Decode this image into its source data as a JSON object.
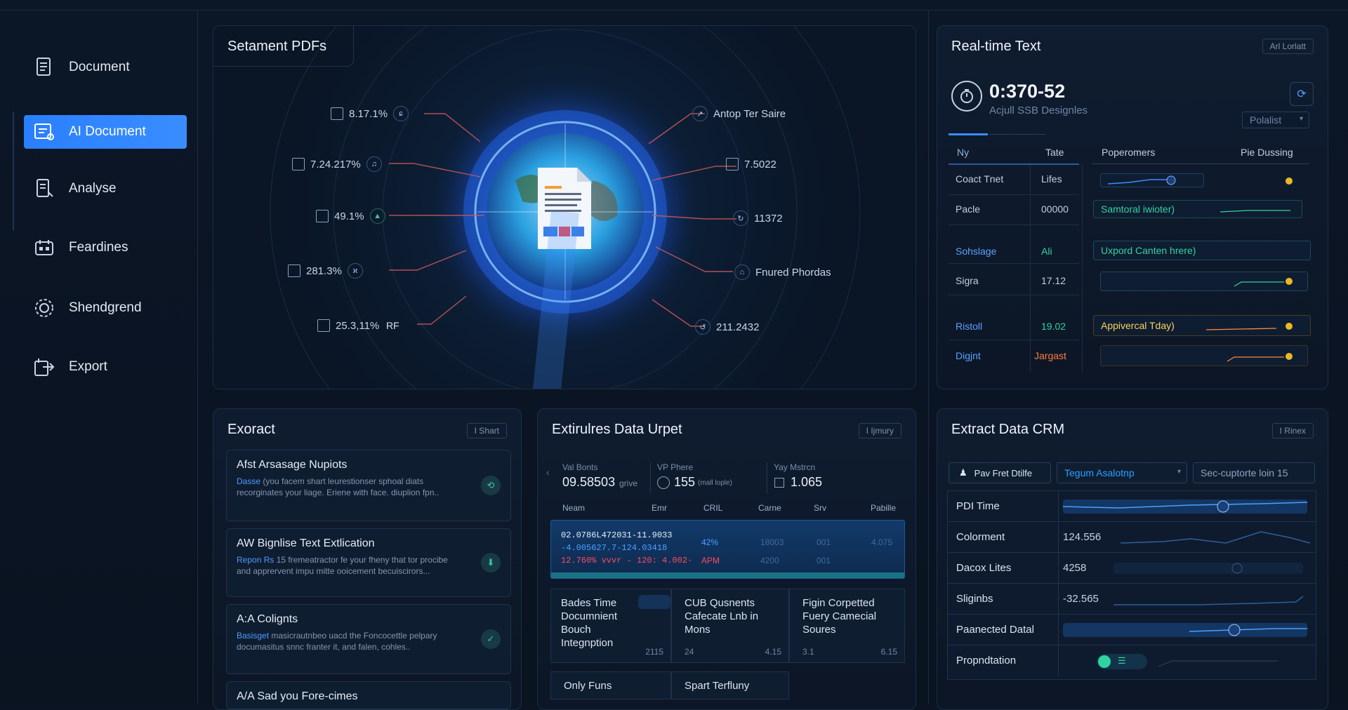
{
  "sidebar": {
    "items": [
      {
        "label": "Document",
        "icon": "document-icon"
      },
      {
        "label": "AI Document",
        "icon": "ai-document-icon",
        "active": true
      },
      {
        "label": "Analyse",
        "icon": "analyse-icon"
      },
      {
        "label": "Feardines",
        "icon": "feardines-icon"
      },
      {
        "label": "Shendgrend",
        "icon": "settings-gear-icon"
      },
      {
        "label": "Export",
        "icon": "export-icon"
      }
    ]
  },
  "viz": {
    "title": "Setament PDFs",
    "left_labels": [
      "8.17.1%",
      "7.24.217%",
      "49.1%",
      "281.3%",
      "25.3,11%"
    ],
    "left_icon_texts": [
      "ɕ",
      "♫",
      "▲",
      "ϰ",
      "RF"
    ],
    "right_labels": [
      "Antop Ter Saire",
      "7.5022",
      "11372",
      "Fnured Phordas",
      "211.2432"
    ]
  },
  "realtime": {
    "title": "Real-time Text",
    "chip": "Arl Lorlatt",
    "time": "0:370-52",
    "subtitle": "Acjull SSB Designles",
    "dropdown": "Polalist",
    "headers": [
      "Ny",
      "Tate",
      "Poperomers",
      "Pie Dussing"
    ],
    "rows": [
      {
        "name": "Coact Tnet",
        "val": "Lifes",
        "bar": ""
      },
      {
        "name": "Pacle",
        "val": "00000",
        "bar": "Samtoral iwioter)"
      },
      {
        "name": "Sohslage",
        "val": "Ali",
        "bar": "Uxpord Canten hrere)"
      },
      {
        "name": "Sigra",
        "val": "17.12",
        "bar": ""
      },
      {
        "name": "Ristoll",
        "val": "19.02",
        "bar": "Appivercal Tday)"
      },
      {
        "name": "Digjnt",
        "val": "Jargast",
        "bar": ""
      }
    ]
  },
  "extract": {
    "title": "Exoract",
    "chip": "I Shart",
    "cards": [
      {
        "title": "Afst Arsasage Nupiots",
        "lead": "Dasse",
        "body": "(you facem shart leurestionser sphoal diats recorginates your liage. Eriene with face. diuplion fpn.."
      },
      {
        "title": "AW Bignlise Text Extlication",
        "lead": "Repon Rs",
        "body": "15 fremeatractor fe your fheny that tor procibe and apprervent impu mitte ooicement becuiscirors..."
      },
      {
        "title": "A:A Colignts",
        "lead": "Basisget",
        "body": "masicrautnbeo uacd the Foncocettle pelpary documasitus snnc franter it, and falen, cohles.."
      },
      {
        "title": "A/A Sad you Fore-cimes",
        "lead": "",
        "body": ""
      }
    ]
  },
  "midtable": {
    "title": "Extirulres Data Urpet",
    "chip": "I Ijmury",
    "stats": [
      {
        "label": "Val Bonts",
        "value": "09.58503",
        "unit": "grive"
      },
      {
        "label": "VP Phere",
        "value": "155",
        "unit": "(mall lople)"
      },
      {
        "label": "Yay Mstrcn",
        "value": "1.065",
        "unit": ""
      }
    ],
    "headers": [
      "Neam",
      "Emr",
      "CRIL",
      "Carne",
      "Srv",
      "Pabille"
    ],
    "highlight_rows": [
      {
        "a": "02.0786L472031-11.9033",
        "b": "42%",
        "c": "18003",
        "d": "001",
        "e": "4.075"
      },
      {
        "a": "-4.005627.7-124.03418",
        "b": "",
        "c": "",
        "d": "",
        "e": ""
      },
      {
        "a": "12.760% vvvr - 120: 4.002·",
        "b": "APM",
        "c": "4200",
        "d": "001",
        "e": ""
      }
    ],
    "boxes": [
      {
        "text": "Bades Time Documnient Bouch Integnption",
        "num": "2115"
      },
      {
        "text": "CUB Qusnents Cafecate Lnb in Mons",
        "num_a": "24",
        "num_b": "4.15"
      },
      {
        "text": "Figin Corpetted Fuery Camecial Soures",
        "num_a": "3.1",
        "num_b": "6.15"
      }
    ],
    "bottom": [
      "Only Funs",
      "Spart Terfluny"
    ]
  },
  "crm": {
    "title": "Extract Data CRM",
    "chip": "I Rinex",
    "filter_button": "Pav Fret Dtilfe",
    "select": "Tegum Asalotnp",
    "filter_text": "Sec-cuptorte loin 15",
    "rows": [
      {
        "label": "PDI Time",
        "value": ""
      },
      {
        "label": "Colorment",
        "value": "124.556"
      },
      {
        "label": "Dacox Lites",
        "value": "4258"
      },
      {
        "label": "Sliginbs",
        "value": "-32.565"
      },
      {
        "label": "Paanected Datal",
        "value": ""
      },
      {
        "label": "Propndtation",
        "value": ""
      }
    ]
  },
  "colors": {
    "accent": "#2f86ff",
    "green": "#2fd2a0",
    "yellow": "#e9b824",
    "red": "#ff4a5a"
  }
}
